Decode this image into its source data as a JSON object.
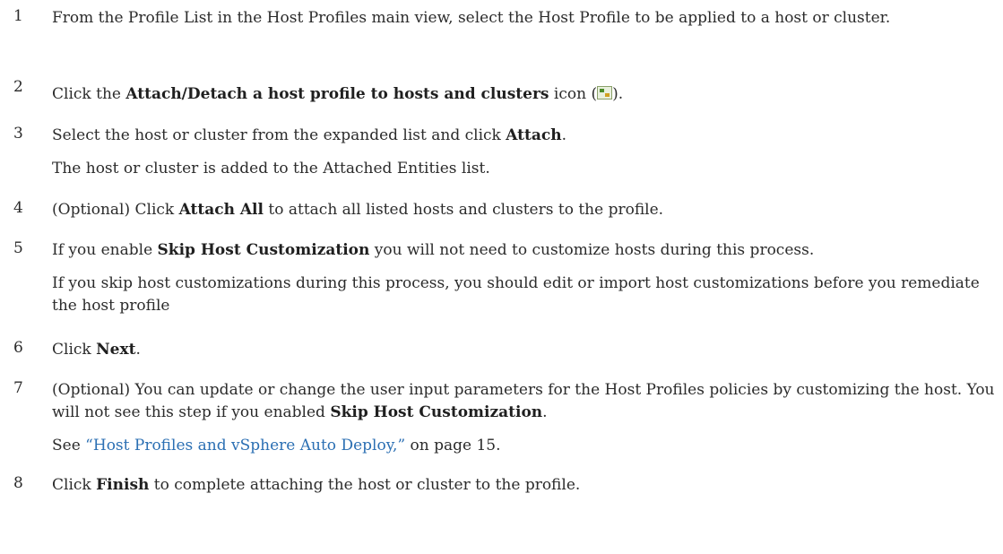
{
  "steps": [
    {
      "num": "1",
      "text": "From the Profile List in the Host Profiles main view, select the Host Profile to be applied to a host or cluster."
    },
    {
      "num": "2",
      "pre": "Click the ",
      "bold": "Attach/Detach a host profile to hosts and clusters",
      "mid": " icon (",
      "icon": "attach-detach-host-profile-icon",
      "post": ")."
    },
    {
      "num": "3",
      "pre": "Select the host or cluster from the expanded list and click ",
      "bold": "Attach",
      "post": ".",
      "note": "The host or cluster is added to the Attached Entities list."
    },
    {
      "num": "4",
      "pre": "(Optional) Click ",
      "bold": "Attach All",
      "post": " to attach all listed hosts and clusters to the profile."
    },
    {
      "num": "5",
      "pre": "If you enable ",
      "bold": "Skip Host Customization",
      "post": " you will not need to customize hosts during this process.",
      "note": "If you skip host customizations during this process, you should edit or import host customizations before you remediate the host profile"
    },
    {
      "num": "6",
      "pre": "Click ",
      "bold": "Next",
      "post": "."
    },
    {
      "num": "7",
      "pre": "(Optional) You can update or change the user input parameters for the Host Profiles policies by customizing the host. You will not see this step if you enabled ",
      "bold": "Skip Host Customization",
      "post": ".",
      "see_pre": "See ",
      "see_link": "“Host Profiles and vSphere Auto Deploy,”",
      "see_post": " on page 15."
    },
    {
      "num": "8",
      "pre": "Click ",
      "bold": "Finish",
      "post": " to complete attaching the host or cluster to the profile."
    }
  ]
}
